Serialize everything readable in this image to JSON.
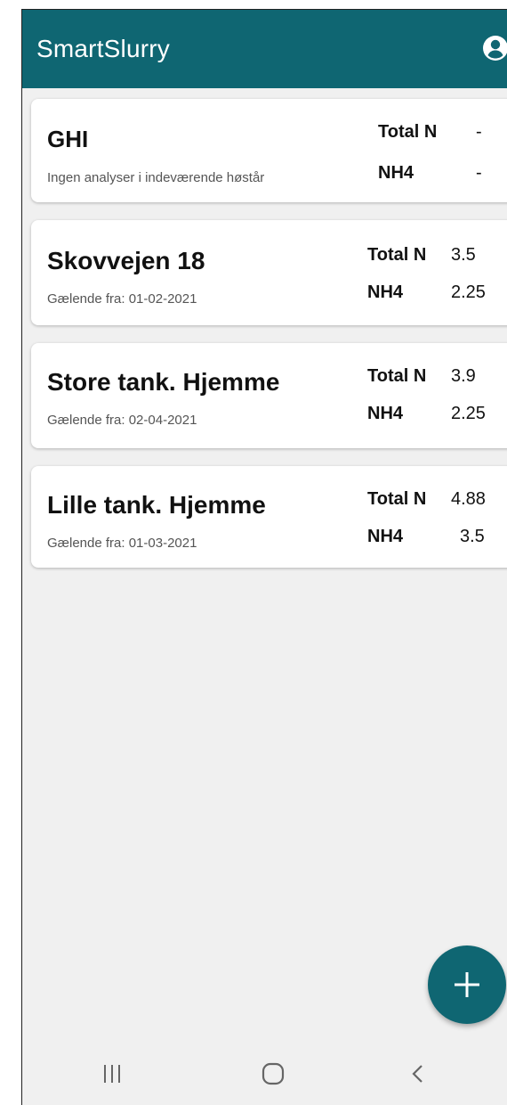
{
  "app": {
    "title": "SmartSlurry"
  },
  "icons": {
    "account": "account-circle-icon",
    "add": "plus-icon",
    "nav_recent": "recent-apps-icon",
    "nav_home": "home-icon",
    "nav_back": "back-icon"
  },
  "colors": {
    "primary": "#0f6672"
  },
  "tanks": [
    {
      "name": "GHI",
      "subtitle": "Ingen analyser i indeværende høstår",
      "total_n_label": "Total N",
      "total_n": "-",
      "nh4_label": "NH4",
      "nh4": "-"
    },
    {
      "name": "Skovvejen 18",
      "subtitle": "Gælende fra: 01-02-2021",
      "total_n_label": "Total N",
      "total_n": "3.5",
      "nh4_label": "NH4",
      "nh4": "2.25"
    },
    {
      "name": "Store tank. Hjemme",
      "subtitle": "Gælende fra: 02-04-2021",
      "total_n_label": "Total N",
      "total_n": "3.9",
      "nh4_label": "NH4",
      "nh4": "2.25"
    },
    {
      "name": "Lille tank. Hjemme",
      "subtitle": "Gælende fra: 01-03-2021",
      "total_n_label": "Total N",
      "total_n": "4.88",
      "nh4_label": "NH4",
      "nh4": "3.5"
    }
  ]
}
